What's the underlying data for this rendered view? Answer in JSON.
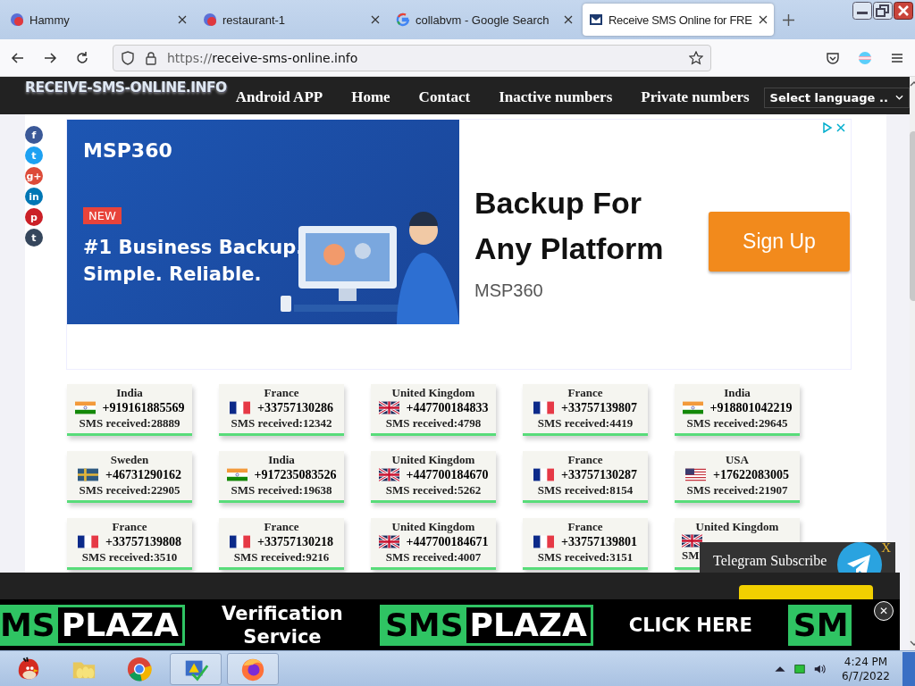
{
  "browser": {
    "tabs": [
      {
        "title": "Hammy",
        "selected": false
      },
      {
        "title": "restaurant-1",
        "selected": false
      },
      {
        "title": "collabvm - Google Search",
        "selected": false
      },
      {
        "title": "Receive SMS Online for FRE",
        "selected": true
      }
    ],
    "url": {
      "scheme": "https://",
      "host": "receive-sms-online.info"
    }
  },
  "site": {
    "logo": "RECEIVE-SMS-ONLINE.INFO",
    "nav": [
      "Android APP",
      "Home",
      "Contact",
      "Inactive numbers",
      "Private numbers"
    ],
    "language": "Select language .."
  },
  "social": [
    {
      "glyph": "f",
      "color": "#3b5998"
    },
    {
      "glyph": "t",
      "color": "#1da1f2"
    },
    {
      "glyph": "g+",
      "color": "#dd4b39"
    },
    {
      "glyph": "in",
      "color": "#0077b5"
    },
    {
      "glyph": "p",
      "color": "#cb2027"
    },
    {
      "glyph": "t",
      "color": "#35465c"
    }
  ],
  "ad": {
    "brand": "MSP360",
    "badge": "NEW",
    "tagline": [
      "#1 Business Backup.",
      "Simple. Reliable."
    ],
    "headline": "Backup For Any Platform",
    "advertiser": "MSP360",
    "button": "Sign Up"
  },
  "numbers": [
    {
      "country": "India",
      "kind": "in",
      "number": "+919161885569",
      "received": "SMS received:28889"
    },
    {
      "country": "France",
      "kind": "fr",
      "number": "+33757130286",
      "received": "SMS received:12342"
    },
    {
      "country": "United Kingdom",
      "kind": "gb",
      "number": "+447700184833",
      "received": "SMS received:4798"
    },
    {
      "country": "France",
      "kind": "fr",
      "number": "+33757139807",
      "received": "SMS received:4419"
    },
    {
      "country": "India",
      "kind": "in",
      "number": "+918801042219",
      "received": "SMS received:29645"
    },
    {
      "country": "Sweden",
      "kind": "se",
      "number": "+46731290162",
      "received": "SMS received:22905"
    },
    {
      "country": "India",
      "kind": "in",
      "number": "+917235083526",
      "received": "SMS received:19638"
    },
    {
      "country": "United Kingdom",
      "kind": "gb",
      "number": "+447700184670",
      "received": "SMS received:5262"
    },
    {
      "country": "France",
      "kind": "fr",
      "number": "+33757130287",
      "received": "SMS received:8154"
    },
    {
      "country": "USA",
      "kind": "us",
      "number": "+17622083005",
      "received": "SMS received:21907"
    },
    {
      "country": "France",
      "kind": "fr",
      "number": "+33757139808",
      "received": "SMS received:3510"
    },
    {
      "country": "France",
      "kind": "fr",
      "number": "+33757130218",
      "received": "SMS received:9216"
    },
    {
      "country": "United Kingdom",
      "kind": "gb",
      "number": "+447700184671",
      "received": "SMS received:4007"
    },
    {
      "country": "France",
      "kind": "fr",
      "number": "+33757139801",
      "received": "SMS received:3151"
    },
    {
      "country": "United Kingdom",
      "kind": "gb",
      "received": "SM"
    }
  ],
  "telegram": {
    "close": "X",
    "label": "Telegram Subscribe"
  },
  "banner": {
    "parts": [
      {
        "kind": "logo",
        "a": "MS",
        "b": "PLAZA"
      },
      {
        "kind": "text",
        "text": "Verification Service"
      },
      {
        "kind": "logo",
        "a": "SMS",
        "b": "PLAZA"
      },
      {
        "kind": "text",
        "text": "CLICK HERE"
      },
      {
        "kind": "stub",
        "a": "SM"
      }
    ],
    "close": "✕"
  },
  "taskbar": {
    "apps": [
      {
        "kind": "bird",
        "open": false
      },
      {
        "kind": "folder",
        "open": false
      },
      {
        "kind": "chrome",
        "open": false
      },
      {
        "kind": "security",
        "open": true
      },
      {
        "kind": "firefox",
        "open": true
      }
    ],
    "time": "4:24 PM",
    "date": "6/7/2022"
  }
}
